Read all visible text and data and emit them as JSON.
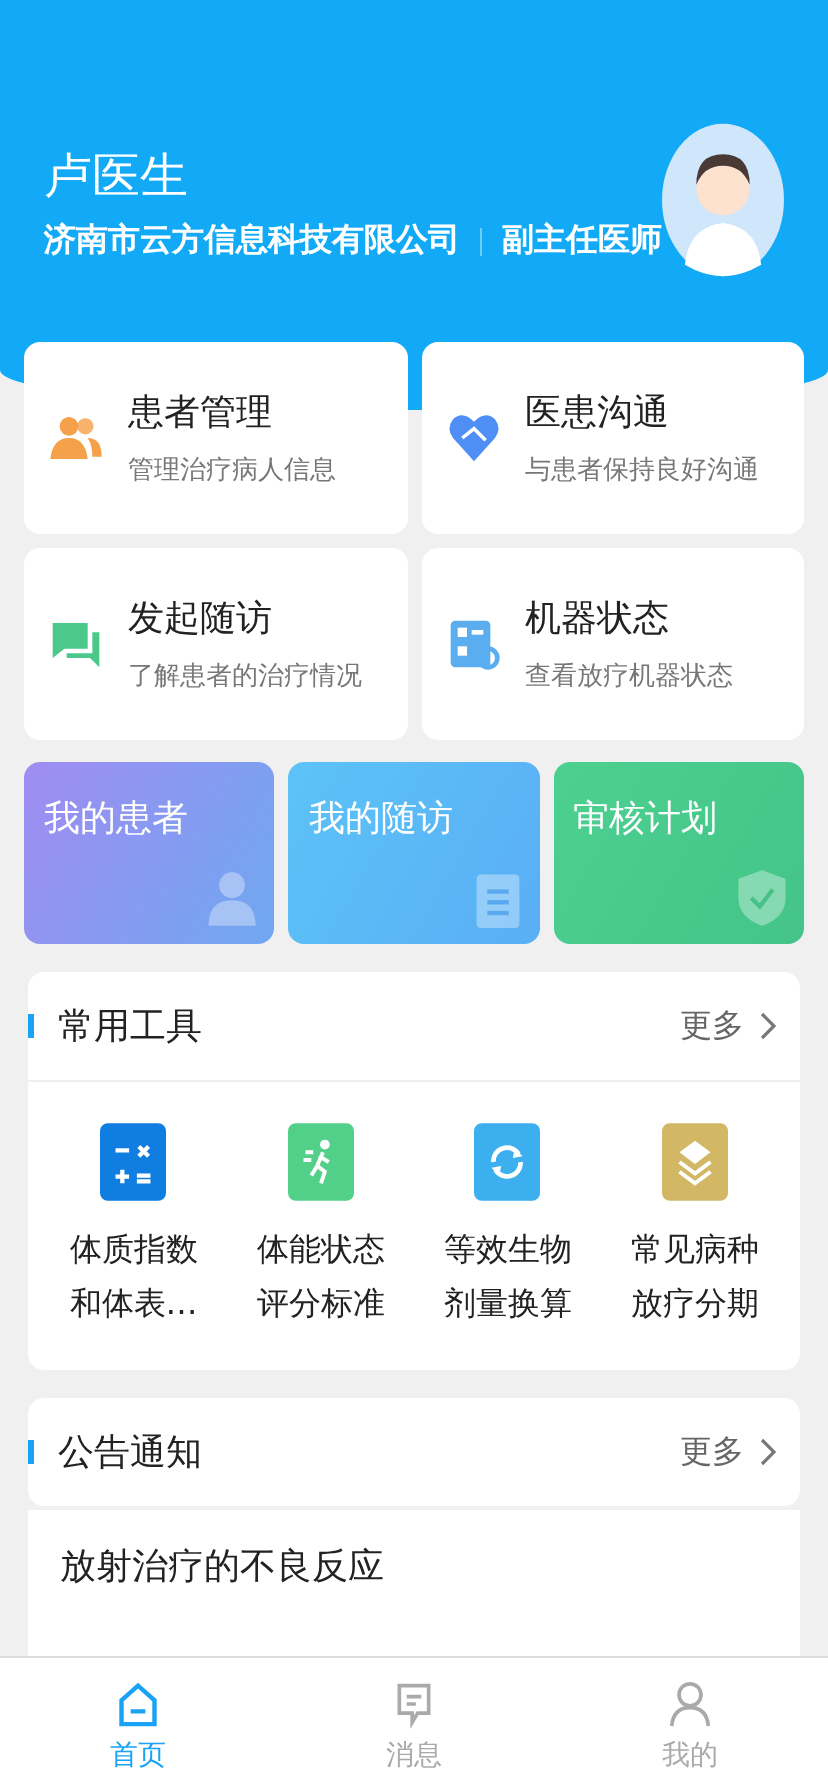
{
  "profile": {
    "name": "卢医生",
    "organization": "济南市云方信息科技有限公司",
    "title": "副主任医师"
  },
  "quick_cards": [
    {
      "kind": "patients",
      "title": "患者管理",
      "subtitle": "管理治疗病人信息"
    },
    {
      "kind": "handshake",
      "title": "医患沟通",
      "subtitle": "与患者保持良好沟通"
    },
    {
      "kind": "chat",
      "title": "发起随访",
      "subtitle": "了解患者的治疗情况"
    },
    {
      "kind": "machine",
      "title": "机器状态",
      "subtitle": "查看放疗机器状态"
    }
  ],
  "shortcut_cards": [
    {
      "kind": "person",
      "label": "我的患者"
    },
    {
      "kind": "clipboard",
      "label": "我的随访"
    },
    {
      "kind": "shield",
      "label": "审核计划"
    }
  ],
  "tools": {
    "title": "常用工具",
    "more": "更多",
    "items": [
      {
        "kind": "calculator",
        "line1": "体质指数",
        "line2": "和体表…"
      },
      {
        "kind": "runner",
        "line1": "体能状态",
        "line2": "评分标准"
      },
      {
        "kind": "refresh",
        "line1": "等效生物",
        "line2": "剂量换算"
      },
      {
        "kind": "layers",
        "line1": "常见病种",
        "line2": "放疗分期"
      }
    ]
  },
  "notices": {
    "title": "公告通知",
    "more": "更多",
    "items": [
      "放射治疗的不良反应"
    ]
  },
  "tab_bar": [
    {
      "kind": "home",
      "label": "首页",
      "selected": true
    },
    {
      "kind": "message",
      "label": "消息",
      "selected": false
    },
    {
      "kind": "user",
      "label": "我的",
      "selected": false
    }
  ]
}
